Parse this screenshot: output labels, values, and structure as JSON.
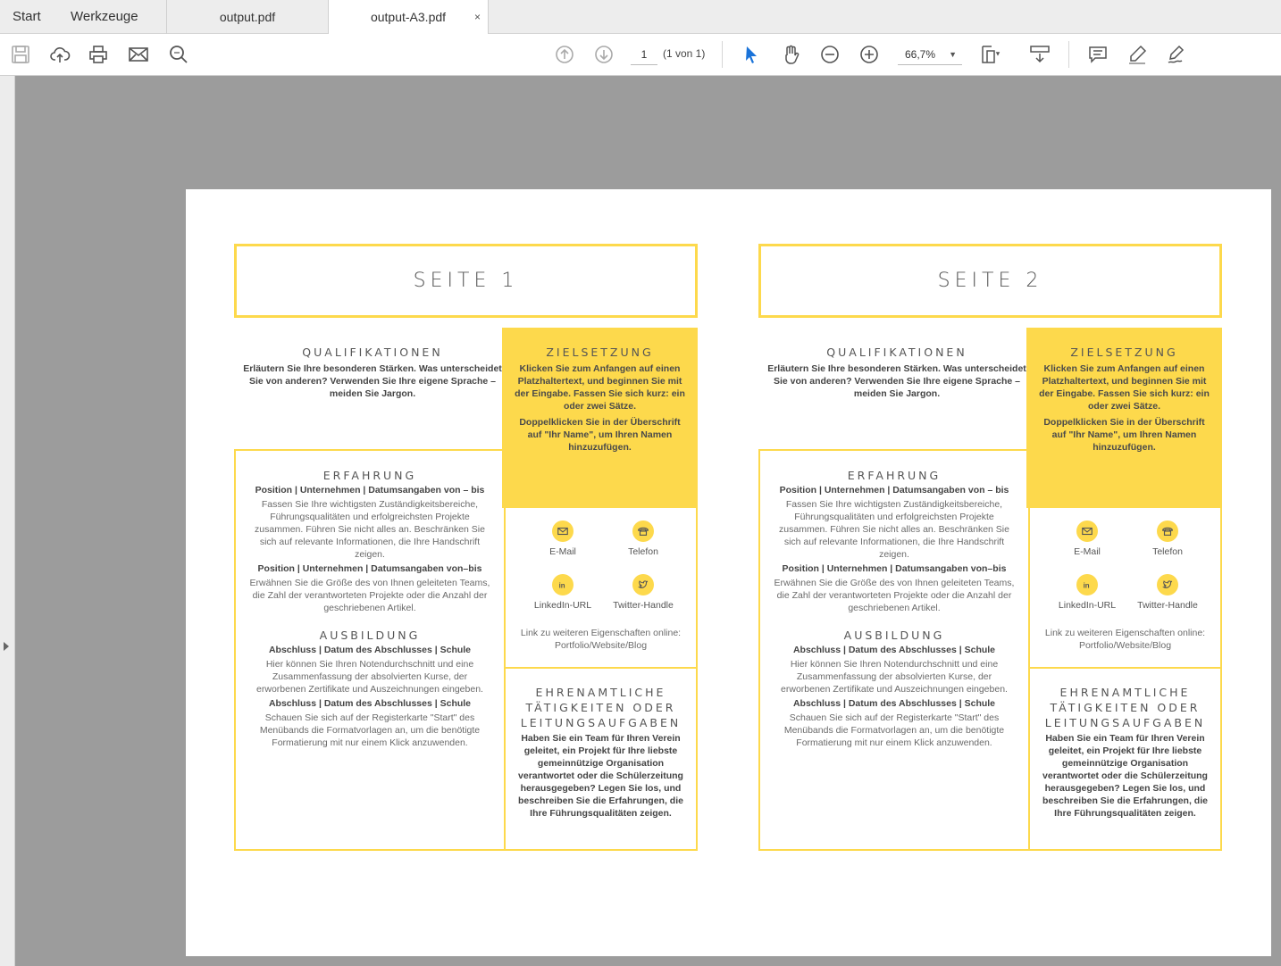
{
  "tabs": {
    "start": "Start",
    "tools": "Werkzeuge",
    "docs": [
      {
        "label": "output.pdf",
        "active": false
      },
      {
        "label": "output-A3.pdf",
        "active": true
      }
    ],
    "close_glyph": "×"
  },
  "toolbar": {
    "page_number": "1",
    "page_of": "(1 von 1)",
    "zoom": "66,7%",
    "icons": [
      "save-icon",
      "cloud-upload-icon",
      "print-icon",
      "mail-icon",
      "zoom-search-icon",
      "page-up-icon",
      "page-down-icon",
      "select-arrow-icon",
      "hand-icon",
      "zoom-out-icon",
      "zoom-in-icon",
      "page-fit-icon",
      "scroll-mode-icon",
      "comment-icon",
      "highlight-pen-icon",
      "sign-icon"
    ]
  },
  "colors": {
    "accent_yellow": "#fdd94c",
    "workspace_gray": "#9c9c9c"
  },
  "resume": {
    "pages": [
      {
        "title": "SEITE 1",
        "qual_heading": "QUALIFIKATIONEN",
        "qual_text": "Erläutern Sie Ihre besonderen Stärken. Was unterscheidet Sie von anderen? Verwenden Sie Ihre eigene Sprache – meiden Sie Jargon.",
        "goal_heading": "ZIELSETZUNG",
        "goal_text1": "Klicken Sie zum Anfangen auf einen Platzhaltertext, und beginnen Sie mit der Eingabe. Fassen Sie sich kurz: ein oder zwei Sätze.",
        "goal_text2": "Doppelklicken Sie in der Überschrift auf \"Ihr Name\", um Ihren Namen hinzuzufügen.",
        "exp_heading": "ERFAHRUNG",
        "exp_line1": "Position | Unternehmen | Datumsangaben von – bis",
        "exp_text1": "Fassen Sie Ihre wichtigsten Zuständigkeitsbereiche, Führungsqualitäten und erfolgreichsten Projekte zusammen. Führen Sie nicht alles an. Beschränken Sie sich auf relevante Informationen, die Ihre Handschrift zeigen.",
        "exp_line2": "Position | Unternehmen | Datumsangaben von–bis",
        "exp_text2": "Erwähnen Sie die Größe des von Ihnen geleiteten Teams, die Zahl der verantworteten Projekte oder die Anzahl der geschriebenen Artikel.",
        "edu_heading": "AUSBILDUNG",
        "edu_line1": "Abschluss | Datum des Abschlusses | Schule",
        "edu_text1": "Hier können Sie Ihren Notendurchschnitt und eine Zusammenfassung der absolvierten Kurse, der erworbenen Zertifikate und Auszeichnungen eingeben.",
        "edu_line2": "Abschluss | Datum des Abschlusses | Schule",
        "edu_text2": "Schauen Sie sich auf der Registerkarte \"Start\" des Menübands die Formatvorlagen an, um die benötigte Formatierung mit nur einem Klick anzuwenden.",
        "contact": {
          "email": "E-Mail",
          "phone": "Telefon",
          "linkedin": "LinkedIn-URL",
          "twitter": "Twitter-Handle",
          "link": "Link zu weiteren Eigenschaften online: Portfolio/Website/Blog"
        },
        "vol_heading": "EHRENAMTLICHE TÄTIGKEITEN ODER LEITUNGSAUFGABEN",
        "vol_text": "Haben Sie ein Team für Ihren Verein geleitet, ein Projekt für Ihre liebste gemeinnützige Organisation verantwortet oder die Schülerzeitung herausgegeben? Legen Sie los, und beschreiben Sie die Erfahrungen, die Ihre Führungsqualitäten zeigen."
      },
      {
        "title": "SEITE 2",
        "qual_heading": "QUALIFIKATIONEN",
        "qual_text": "Erläutern Sie Ihre besonderen Stärken. Was unterscheidet Sie von anderen? Verwenden Sie Ihre eigene Sprache – meiden Sie Jargon.",
        "goal_heading": "ZIELSETZUNG",
        "goal_text1": "Klicken Sie zum Anfangen auf einen Platzhaltertext, und beginnen Sie mit der Eingabe. Fassen Sie sich kurz: ein oder zwei Sätze.",
        "goal_text2": "Doppelklicken Sie in der Überschrift auf \"Ihr Name\", um Ihren Namen hinzuzufügen.",
        "exp_heading": "ERFAHRUNG",
        "exp_line1": "Position | Unternehmen | Datumsangaben von – bis",
        "exp_text1": "Fassen Sie Ihre wichtigsten Zuständigkeitsbereiche, Führungsqualitäten und erfolgreichsten Projekte zusammen. Führen Sie nicht alles an. Beschränken Sie sich auf relevante Informationen, die Ihre Handschrift zeigen.",
        "exp_line2": "Position | Unternehmen | Datumsangaben von–bis",
        "exp_text2": "Erwähnen Sie die Größe des von Ihnen geleiteten Teams, die Zahl der verantworteten Projekte oder die Anzahl der geschriebenen Artikel.",
        "edu_heading": "AUSBILDUNG",
        "edu_line1": "Abschluss | Datum des Abschlusses | Schule",
        "edu_text1": "Hier können Sie Ihren Notendurchschnitt und eine Zusammenfassung der absolvierten Kurse, der erworbenen Zertifikate und Auszeichnungen eingeben.",
        "edu_line2": "Abschluss | Datum des Abschlusses | Schule",
        "edu_text2": "Schauen Sie sich auf der Registerkarte \"Start\" des Menübands die Formatvorlagen an, um die benötigte Formatierung mit nur einem Klick anzuwenden.",
        "contact": {
          "email": "E-Mail",
          "phone": "Telefon",
          "linkedin": "LinkedIn-URL",
          "twitter": "Twitter-Handle",
          "link": "Link zu weiteren Eigenschaften online: Portfolio/Website/Blog"
        },
        "vol_heading": "EHRENAMTLICHE TÄTIGKEITEN ODER LEITUNGSAUFGABEN",
        "vol_text": "Haben Sie ein Team für Ihren Verein geleitet, ein Projekt für Ihre liebste gemeinnützige Organisation verantwortet oder die Schülerzeitung herausgegeben? Legen Sie los, und beschreiben Sie die Erfahrungen, die Ihre Führungsqualitäten zeigen."
      }
    ]
  }
}
